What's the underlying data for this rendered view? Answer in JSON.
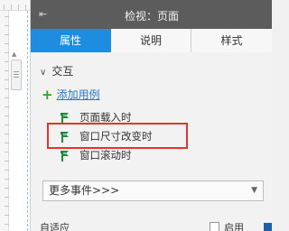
{
  "panel": {
    "title": "检视：页面",
    "tabs": [
      {
        "label": "属性",
        "active": true
      },
      {
        "label": "说明",
        "active": false
      },
      {
        "label": "样式",
        "active": false
      }
    ]
  },
  "interaction": {
    "section_label": "交互",
    "add_case_label": "添加用例",
    "events": [
      {
        "label": "页面载入时",
        "highlighted": false
      },
      {
        "label": "窗口尺寸改变时",
        "highlighted": true
      },
      {
        "label": "窗口滚动时",
        "highlighted": false
      }
    ],
    "more_events": "更多事件>>>"
  },
  "bottom_row": {
    "label": "自适应",
    "checkbox_label": "启用"
  },
  "colors": {
    "tab_active": "#1f8ddf",
    "titlebar": "#5c5c5c",
    "highlight_border": "#e2342d",
    "link": "#2a78c6",
    "plus": "#2fa12f",
    "event_flag": "#1e8a3c"
  },
  "icons": {
    "collapse": "collapse-icon",
    "section_chevron": "chevron-down-icon",
    "add": "plus-icon",
    "event": "event-flag-icon",
    "select_caret": "chevron-down-icon"
  }
}
